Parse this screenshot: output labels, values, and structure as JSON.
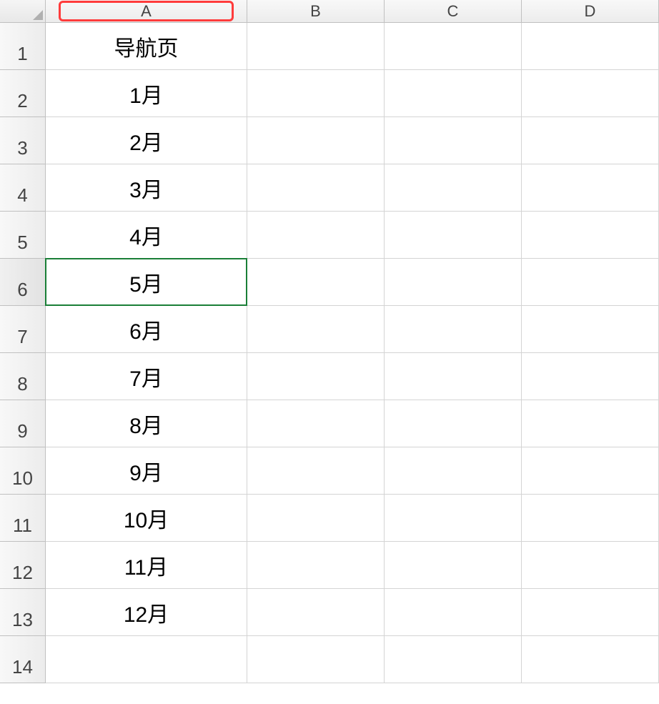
{
  "columns": [
    "A",
    "B",
    "C",
    "D"
  ],
  "highlighted_column_index": 0,
  "selected_row": 6,
  "row_count": 14,
  "cells": {
    "A1": "导航页",
    "A2": "1月",
    "A3": "2月",
    "A4": "3月",
    "A5": "4月",
    "A6": "5月",
    "A7": "6月",
    "A8": "7月",
    "A9": "8月",
    "A10": "9月",
    "A11": "10月",
    "A12": "11月",
    "A13": "12月"
  }
}
